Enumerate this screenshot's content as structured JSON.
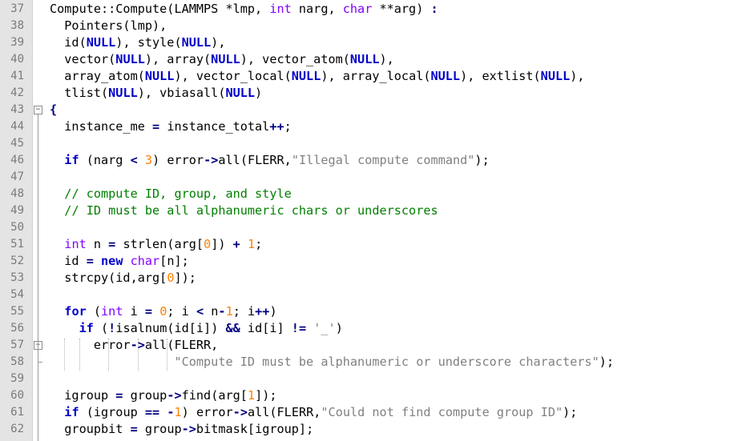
{
  "editor": {
    "lines": [
      {
        "n": "37",
        "tokens": [
          [
            "Compute::Compute(LAMMPS *lmp, ",
            ""
          ],
          [
            "int",
            "ty"
          ],
          [
            " narg, ",
            ""
          ],
          [
            "char",
            "ty"
          ],
          [
            " **arg) ",
            ""
          ],
          [
            ":",
            "op"
          ]
        ]
      },
      {
        "n": "38",
        "tokens": [
          [
            "  Pointers(lmp),",
            ""
          ]
        ]
      },
      {
        "n": "39",
        "tokens": [
          [
            "  id(",
            ""
          ],
          [
            "NULL",
            "kw"
          ],
          [
            "), style(",
            ""
          ],
          [
            "NULL",
            "kw"
          ],
          [
            "),",
            ""
          ]
        ]
      },
      {
        "n": "40",
        "tokens": [
          [
            "  vector(",
            ""
          ],
          [
            "NULL",
            "kw"
          ],
          [
            "), array(",
            ""
          ],
          [
            "NULL",
            "kw"
          ],
          [
            "), vector_atom(",
            ""
          ],
          [
            "NULL",
            "kw"
          ],
          [
            "),",
            ""
          ]
        ]
      },
      {
        "n": "41",
        "tokens": [
          [
            "  array_atom(",
            ""
          ],
          [
            "NULL",
            "kw"
          ],
          [
            "), vector_local(",
            ""
          ],
          [
            "NULL",
            "kw"
          ],
          [
            "), array_local(",
            ""
          ],
          [
            "NULL",
            "kw"
          ],
          [
            "), extlist(",
            ""
          ],
          [
            "NULL",
            "kw"
          ],
          [
            "),",
            ""
          ]
        ]
      },
      {
        "n": "42",
        "tokens": [
          [
            "  tlist(",
            ""
          ],
          [
            "NULL",
            "kw"
          ],
          [
            "), vbiasall(",
            ""
          ],
          [
            "NULL",
            "kw"
          ],
          [
            ")",
            ""
          ]
        ]
      },
      {
        "n": "43",
        "tokens": [
          [
            "{",
            "op"
          ]
        ]
      },
      {
        "n": "44",
        "tokens": [
          [
            "  instance_me ",
            ""
          ],
          [
            "=",
            "op"
          ],
          [
            " instance_total",
            ""
          ],
          [
            "++",
            "op"
          ],
          [
            ";",
            ""
          ]
        ]
      },
      {
        "n": "45",
        "tokens": []
      },
      {
        "n": "46",
        "tokens": [
          [
            "  ",
            ""
          ],
          [
            "if",
            "kw"
          ],
          [
            " (narg ",
            ""
          ],
          [
            "<",
            "op"
          ],
          [
            " ",
            ""
          ],
          [
            "3",
            "num"
          ],
          [
            ") error",
            ""
          ],
          [
            "->",
            "op"
          ],
          [
            "all(FLERR,",
            ""
          ],
          [
            "\"Illegal compute command\"",
            "str"
          ],
          [
            ");",
            ""
          ]
        ]
      },
      {
        "n": "47",
        "tokens": []
      },
      {
        "n": "48",
        "tokens": [
          [
            "  ",
            ""
          ],
          [
            "// compute ID, group, and style",
            "cm"
          ]
        ]
      },
      {
        "n": "49",
        "tokens": [
          [
            "  ",
            ""
          ],
          [
            "// ID must be all alphanumeric chars or underscores",
            "cm"
          ]
        ]
      },
      {
        "n": "50",
        "tokens": []
      },
      {
        "n": "51",
        "tokens": [
          [
            "  ",
            ""
          ],
          [
            "int",
            "ty"
          ],
          [
            " n ",
            ""
          ],
          [
            "=",
            "op"
          ],
          [
            " strlen(arg[",
            ""
          ],
          [
            "0",
            "num"
          ],
          [
            "]) ",
            ""
          ],
          [
            "+",
            "op"
          ],
          [
            " ",
            ""
          ],
          [
            "1",
            "num"
          ],
          [
            ";",
            ""
          ]
        ]
      },
      {
        "n": "52",
        "tokens": [
          [
            "  id ",
            ""
          ],
          [
            "=",
            "op"
          ],
          [
            " ",
            ""
          ],
          [
            "new",
            "kw"
          ],
          [
            " ",
            ""
          ],
          [
            "char",
            "ty"
          ],
          [
            "[n];",
            ""
          ]
        ]
      },
      {
        "n": "53",
        "tokens": [
          [
            "  strcpy(id,arg[",
            ""
          ],
          [
            "0",
            "num"
          ],
          [
            "]);",
            ""
          ]
        ]
      },
      {
        "n": "54",
        "tokens": []
      },
      {
        "n": "55",
        "tokens": [
          [
            "  ",
            ""
          ],
          [
            "for",
            "kw"
          ],
          [
            " (",
            ""
          ],
          [
            "int",
            "ty"
          ],
          [
            " i ",
            ""
          ],
          [
            "=",
            "op"
          ],
          [
            " ",
            ""
          ],
          [
            "0",
            "num"
          ],
          [
            "; i ",
            ""
          ],
          [
            "<",
            "op"
          ],
          [
            " n",
            ""
          ],
          [
            "-",
            "op"
          ],
          [
            "1",
            "num"
          ],
          [
            "; i",
            ""
          ],
          [
            "++",
            "op"
          ],
          [
            ")",
            ""
          ]
        ]
      },
      {
        "n": "56",
        "tokens": [
          [
            "    ",
            ""
          ],
          [
            "if",
            "kw"
          ],
          [
            " (",
            ""
          ],
          [
            "!",
            "op"
          ],
          [
            "isalnum(id[i]) ",
            ""
          ],
          [
            "&&",
            "op"
          ],
          [
            " id[i] ",
            ""
          ],
          [
            "!=",
            "op"
          ],
          [
            " ",
            ""
          ],
          [
            "'_'",
            "str"
          ],
          [
            ")",
            ""
          ]
        ]
      },
      {
        "n": "57",
        "tokens": [
          [
            "      error",
            ""
          ],
          [
            "->",
            "op"
          ],
          [
            "all(FLERR,",
            ""
          ]
        ]
      },
      {
        "n": "58",
        "tokens": [
          [
            "                 ",
            ""
          ],
          [
            "\"Compute ID must be alphanumeric or underscore characters\"",
            "str"
          ],
          [
            ");",
            ""
          ]
        ]
      },
      {
        "n": "59",
        "tokens": []
      },
      {
        "n": "60",
        "tokens": [
          [
            "  igroup ",
            ""
          ],
          [
            "=",
            "op"
          ],
          [
            " group",
            ""
          ],
          [
            "->",
            "op"
          ],
          [
            "find(arg[",
            ""
          ],
          [
            "1",
            "num"
          ],
          [
            "]);",
            ""
          ]
        ]
      },
      {
        "n": "61",
        "tokens": [
          [
            "  ",
            ""
          ],
          [
            "if",
            "kw"
          ],
          [
            " (igroup ",
            ""
          ],
          [
            "==",
            "op"
          ],
          [
            " ",
            ""
          ],
          [
            "-",
            "op"
          ],
          [
            "1",
            "num"
          ],
          [
            ") error",
            ""
          ],
          [
            "->",
            "op"
          ],
          [
            "all(FLERR,",
            ""
          ],
          [
            "\"Could not find compute group ID\"",
            "str"
          ],
          [
            ");",
            ""
          ]
        ]
      },
      {
        "n": "62",
        "tokens": [
          [
            "  groupbit ",
            ""
          ],
          [
            "=",
            "op"
          ],
          [
            " group",
            ""
          ],
          [
            "->",
            "op"
          ],
          [
            "bitmask[igroup];",
            ""
          ]
        ]
      }
    ],
    "fold_markers": [
      {
        "line": "43",
        "symbol": "−"
      },
      {
        "line": "57",
        "symbol": "−"
      }
    ]
  },
  "colors": {
    "keyword": "#0000c8",
    "type": "#8000ff",
    "number": "#ff8000",
    "string": "#808080",
    "comment": "#008000",
    "operator": "#000080",
    "gutter": "#e4e4e4",
    "line_number": "#7a7a7a"
  }
}
